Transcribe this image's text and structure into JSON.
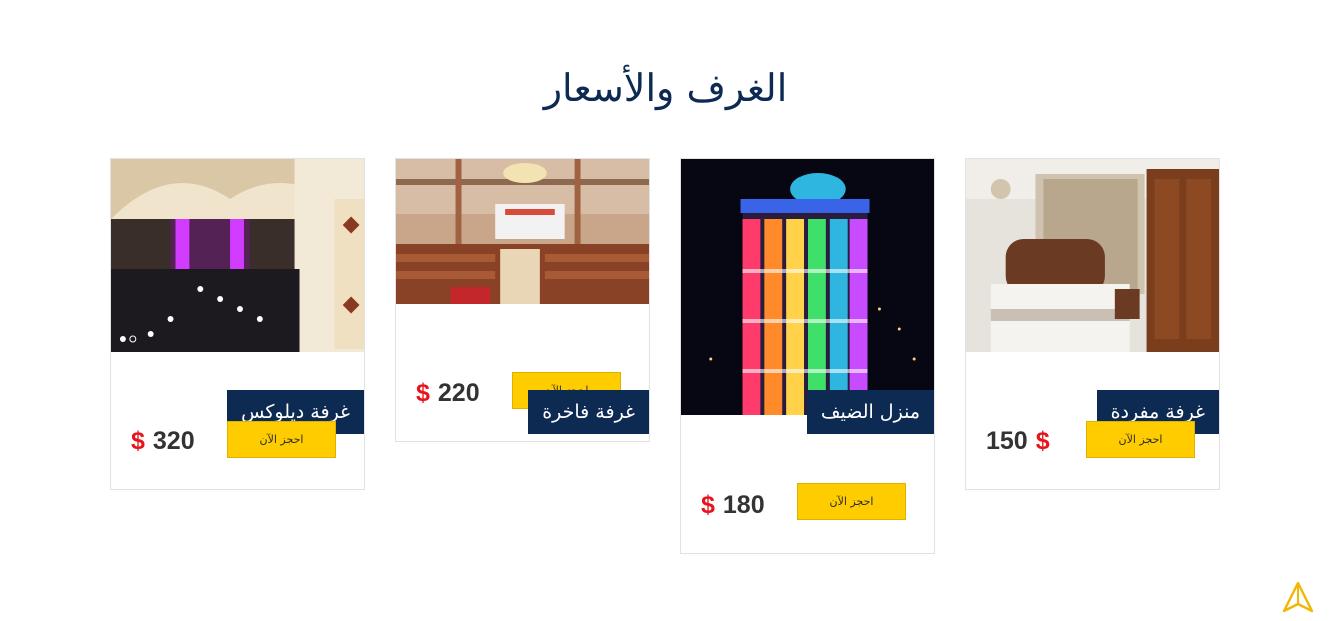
{
  "section": {
    "title": "الغرف والأسعار"
  },
  "rooms": [
    {
      "name": "غرفة مفردة",
      "book_label": "احجز الآن",
      "price": "150",
      "currency": "$"
    },
    {
      "name": "منزل الضيف",
      "book_label": "احجز الآن",
      "price": "180",
      "currency": "$"
    },
    {
      "name": "غرفة فاخرة",
      "book_label": "احجز الآن",
      "price": "220",
      "currency": "$"
    },
    {
      "name": "غرفة ديلوكس",
      "book_label": "احجز الآن",
      "price": "320",
      "currency": "$"
    }
  ],
  "colors": {
    "title": "#0d2a52",
    "name_tag_bg": "#0d2a52",
    "button_bg": "#ffcc00",
    "currency": "#e8141c",
    "scroll_icon": "#f2b705"
  },
  "icons": {
    "scroll_top": "triangle-arrow-up-icon"
  }
}
